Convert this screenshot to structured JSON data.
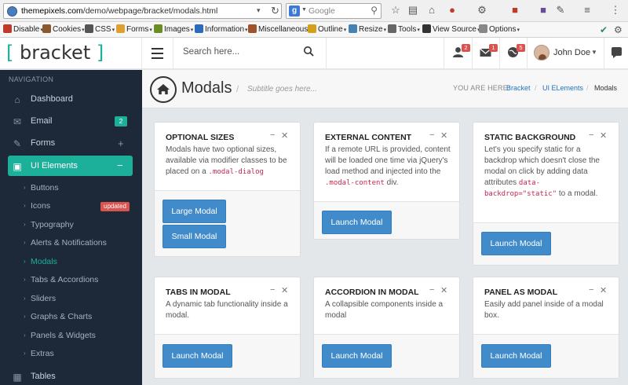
{
  "browser": {
    "url_host": "themepixels.com",
    "url_path": "/demo/webpage/bracket/modals.html",
    "search_placeholder": "Google",
    "bookmarks": [
      {
        "label": "Disable",
        "color": "#c0392b"
      },
      {
        "label": "Cookies",
        "color": "#8b5a2b"
      },
      {
        "label": "CSS",
        "color": "#555555"
      },
      {
        "label": "Forms",
        "color": "#e0a030"
      },
      {
        "label": "Images",
        "color": "#6b8e23"
      },
      {
        "label": "Information",
        "color": "#2a6bbf"
      },
      {
        "label": "Miscellaneous",
        "color": "#a0522d"
      },
      {
        "label": "Outline",
        "color": "#d4a017"
      },
      {
        "label": "Resize",
        "color": "#4682b4"
      },
      {
        "label": "Tools",
        "color": "#666666"
      },
      {
        "label": "View Source",
        "color": "#333333"
      },
      {
        "label": "Options",
        "color": "#888888"
      }
    ]
  },
  "header": {
    "logo_word": "bracket",
    "search_placeholder": "Search here...",
    "notifications": [
      {
        "icon": "user-icon",
        "count": "2"
      },
      {
        "icon": "envelope-icon",
        "count": "1"
      },
      {
        "icon": "globe-icon",
        "count": "5"
      }
    ],
    "user_name": "John Doe"
  },
  "sidebar": {
    "title": "NAVIGATION",
    "items": [
      {
        "label": "Dashboard",
        "icon": "home-icon"
      },
      {
        "label": "Email",
        "icon": "envelope-icon",
        "badge": "2"
      },
      {
        "label": "Forms",
        "icon": "edit-icon"
      },
      {
        "label": "UI Elements",
        "icon": "suitcase-icon"
      },
      {
        "label": "Tables",
        "icon": "table-icon"
      }
    ],
    "subitems": [
      {
        "label": "Buttons"
      },
      {
        "label": "Icons",
        "tag": "updated"
      },
      {
        "label": "Typography"
      },
      {
        "label": "Alerts & Notifications"
      },
      {
        "label": "Modals"
      },
      {
        "label": "Tabs & Accordions"
      },
      {
        "label": "Sliders"
      },
      {
        "label": "Graphs & Charts"
      },
      {
        "label": "Panels & Widgets"
      },
      {
        "label": "Extras"
      }
    ]
  },
  "pageheader": {
    "title": "Modals",
    "subtitle": "Subtitle goes here...",
    "breadcrumb_label": "YOU ARE HERE:",
    "breadcrumb": [
      "Bracket",
      "UI ELements",
      "Modals"
    ]
  },
  "panels": [
    {
      "title": "OPTIONAL SIZES",
      "body": [
        "Modals have two optional sizes, available via modifier classes to be placed on a "
      ],
      "code": ".modal-dialog",
      "buttons": [
        "Large Modal",
        "Small Modal"
      ]
    },
    {
      "title": "EXTERNAL CONTENT",
      "body": [
        "If a remote URL is provided, content will be loaded one time via jQuery's load method and injected into the "
      ],
      "code": ".modal-content",
      "body_after": " div.",
      "buttons": [
        "Launch Modal"
      ]
    },
    {
      "title": "STATIC BACKGROUND",
      "body": [
        "Let's you specify static for a backdrop which doesn't close the modal on click by adding data attributes "
      ],
      "code": "data-backdrop=\"static\"",
      "body_after": " to a modal.",
      "buttons": [
        "Launch Modal"
      ]
    },
    {
      "title": "TABS IN MODAL",
      "body": [
        "A dynamic tab functionality inside a modal."
      ],
      "buttons": [
        "Launch Modal"
      ]
    },
    {
      "title": "ACCORDION IN MODAL",
      "body": [
        "A collapsible components inside a modal"
      ],
      "buttons": [
        "Launch Modal"
      ]
    },
    {
      "title": "PANEL AS MODAL",
      "body": [
        "Easily add panel inside of a modal box."
      ],
      "buttons": [
        "Launch Modal"
      ]
    }
  ]
}
